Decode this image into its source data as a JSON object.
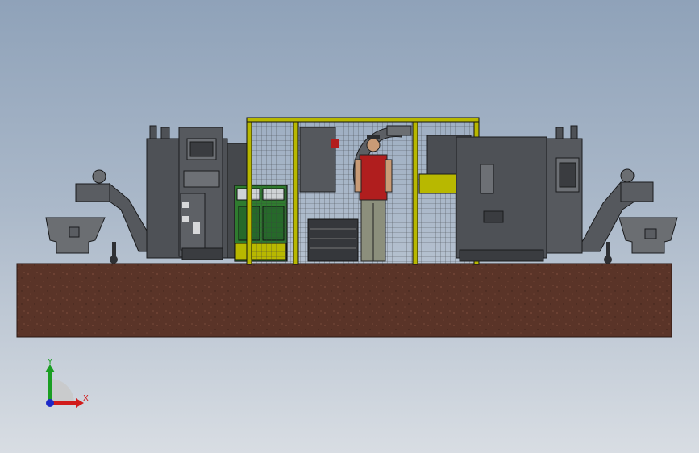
{
  "viewport": {
    "background_top": "#8fa2b9",
    "background_bottom": "#d8dde3"
  },
  "model": {
    "machine_color": "#4e5156",
    "machine_dark": "#2e3034",
    "machine_line": "#1a1b1d",
    "fence_color": "#b8b800",
    "cabinet_color": "#2f7c2f",
    "floor_color": "#5a3428",
    "worker_shirt": "#b01e1e",
    "worker_pants": "#8c8f7c"
  },
  "triad": {
    "x_label": "X",
    "y_label": "Y",
    "x_color": "#d11b1b",
    "y_color": "#1a9e22",
    "z_color": "#1c28c8"
  }
}
